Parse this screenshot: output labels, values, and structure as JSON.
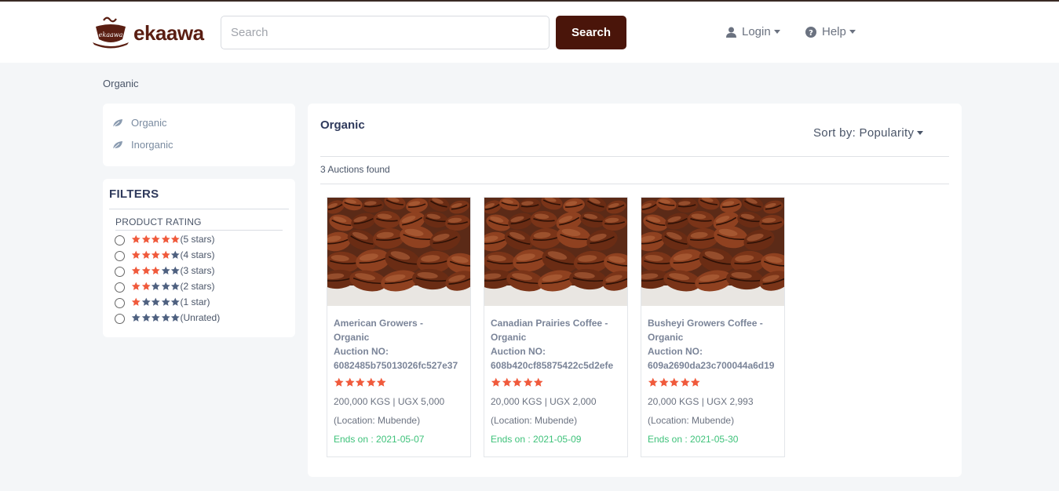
{
  "header": {
    "logo_text": "ekaawa",
    "logo_mark_text": "ekaawa",
    "search_placeholder": "Search",
    "search_button": "Search",
    "login_label": "Login",
    "help_label": "Help"
  },
  "breadcrumb": "Organic",
  "categories": [
    {
      "label": "Organic",
      "icon": "leaf-icon"
    },
    {
      "label": "Inorganic",
      "icon": "leaf-icon"
    }
  ],
  "filters": {
    "title": "FILTERS",
    "rating_title": "PRODUCT RATING",
    "ratings": [
      {
        "label": "(5 stars)",
        "stars": 5
      },
      {
        "label": "(4 stars)",
        "stars": 4
      },
      {
        "label": "(3 stars)",
        "stars": 3
      },
      {
        "label": "(2 stars)",
        "stars": 2
      },
      {
        "label": "(1 star)",
        "stars": 1
      },
      {
        "label": "(Unrated)",
        "stars": 0
      }
    ]
  },
  "main": {
    "title": "Organic",
    "sort_label": "Sort by: Popularity",
    "found_text": "3 Auctions found"
  },
  "products": [
    {
      "title_line1": "American Growers -",
      "title_line2": "Organic",
      "auction_label": "Auction NO:",
      "auction_no": "6082485b75013026fc527e37",
      "rating": 5,
      "quantity_price": "200,000 KGS | UGX 5,000",
      "location": "(Location: Mubende)",
      "ends": "Ends on : 2021-05-07"
    },
    {
      "title_line1": "Canadian Prairies Coffee -",
      "title_line2": "Organic",
      "auction_label": "Auction NO:",
      "auction_no": "608b420cf85875422c5d2efe",
      "rating": 5,
      "quantity_price": "20,000 KGS | UGX 2,000",
      "location": "(Location: Mubende)",
      "ends": "Ends on : 2021-05-09"
    },
    {
      "title_line1": "Busheyi Growers Coffee -",
      "title_line2": "Organic",
      "auction_label": "Auction NO:",
      "auction_no": "609a2690da23c700044a6d19",
      "rating": 5,
      "quantity_price": "20,000 KGS | UGX 2,993",
      "location": "(Location: Mubende)",
      "ends": "Ends on : 2021-05-30"
    }
  ],
  "colors": {
    "brand": "#4a150a",
    "star_filled": "#f05a3c",
    "star_empty": "#4f6180",
    "ends_green": "#3ec27a"
  }
}
